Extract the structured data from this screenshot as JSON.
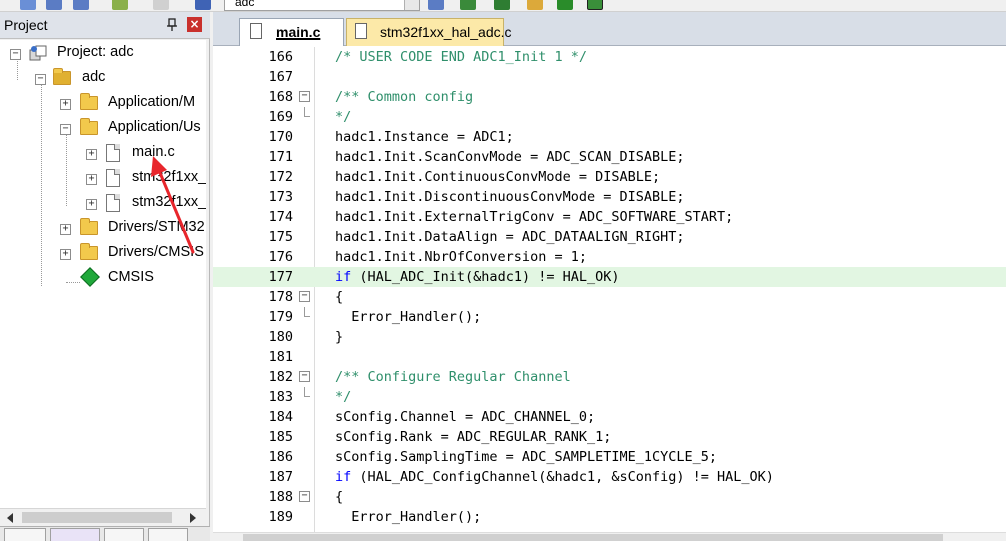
{
  "toolbar": {
    "target_combo_value": "adc"
  },
  "project_panel": {
    "title": "Project",
    "pin_glyph": "ᵖ",
    "close_glyph": "×",
    "tree": [
      {
        "label": "Project: adc",
        "icon": "project-icon",
        "expander": "−"
      },
      {
        "label": "adc",
        "icon": "target-folder-icon",
        "expander": "−"
      },
      {
        "label": "Application/M",
        "icon": "folder-icon",
        "expander": "+"
      },
      {
        "label": "Application/Us",
        "icon": "folder-open-icon",
        "expander": "−"
      },
      {
        "label": "main.c",
        "icon": "file-icon",
        "expander": "+"
      },
      {
        "label": "stm32f1xx_",
        "icon": "file-icon",
        "expander": "+"
      },
      {
        "label": "stm32f1xx_",
        "icon": "file-icon",
        "expander": "+"
      },
      {
        "label": "Drivers/STM32",
        "icon": "folder-icon",
        "expander": "+"
      },
      {
        "label": "Drivers/CMSIS",
        "icon": "folder-icon",
        "expander": "+"
      },
      {
        "label": "CMSIS",
        "icon": "cmsis-icon",
        "expander": ""
      }
    ]
  },
  "editor": {
    "tabs": [
      {
        "label": "main.c",
        "active": true
      },
      {
        "label": "stm32f1xx_hal_adc.c",
        "active": false
      }
    ],
    "lines": [
      {
        "num": "166",
        "text": "/* USER CODE END ADC1_Init 1 */"
      },
      {
        "num": "167",
        "text": ""
      },
      {
        "num": "168",
        "text": "/** Common config"
      },
      {
        "num": "169",
        "text": "*/"
      },
      {
        "num": "170",
        "text": "hadc1.Instance = ADC1;"
      },
      {
        "num": "171",
        "text": "hadc1.Init.ScanConvMode = ADC_SCAN_DISABLE;"
      },
      {
        "num": "172",
        "text": "hadc1.Init.ContinuousConvMode = DISABLE;"
      },
      {
        "num": "173",
        "text": "hadc1.Init.DiscontinuousConvMode = DISABLE;"
      },
      {
        "num": "174",
        "text": "hadc1.Init.ExternalTrigConv = ADC_SOFTWARE_START;"
      },
      {
        "num": "175",
        "text": "hadc1.Init.DataAlign = ADC_DATAALIGN_RIGHT;"
      },
      {
        "num": "176",
        "text": "hadc1.Init.NbrOfConversion = 1;"
      },
      {
        "num": "177",
        "text": "if (HAL_ADC_Init(&hadc1) != HAL_OK)"
      },
      {
        "num": "178",
        "text": "{"
      },
      {
        "num": "179",
        "text": "  Error_Handler();"
      },
      {
        "num": "180",
        "text": "}"
      },
      {
        "num": "181",
        "text": ""
      },
      {
        "num": "182",
        "text": "/** Configure Regular Channel"
      },
      {
        "num": "183",
        "text": "*/"
      },
      {
        "num": "184",
        "text": "sConfig.Channel = ADC_CHANNEL_0;"
      },
      {
        "num": "185",
        "text": "sConfig.Rank = ADC_REGULAR_RANK_1;"
      },
      {
        "num": "186",
        "text": "sConfig.SamplingTime = ADC_SAMPLETIME_1CYCLE_5;"
      },
      {
        "num": "187",
        "text": "if (HAL_ADC_ConfigChannel(&hadc1, &sConfig) != HAL_OK)"
      },
      {
        "num": "188",
        "text": "{"
      },
      {
        "num": "189",
        "text": "  Error_Handler();"
      }
    ],
    "current_line": "177"
  },
  "colors": {
    "comment": "#2f8f6b",
    "keyword": "#0000ff",
    "current_line_bg": "#e2f6e2",
    "annotation_arrow": "#e8262c"
  }
}
